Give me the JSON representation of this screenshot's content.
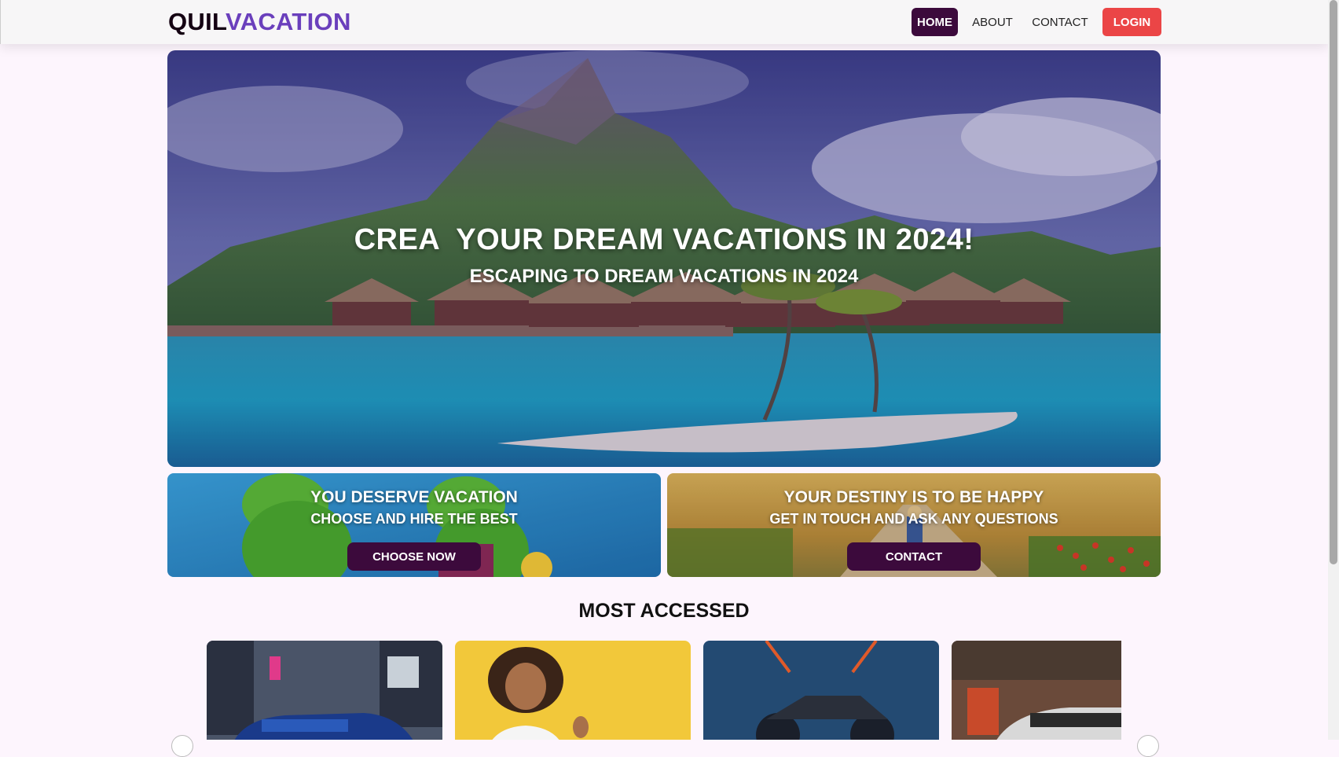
{
  "header": {
    "logo_part1": "QUIL",
    "logo_part2": "VACATION",
    "nav": {
      "home": "HOME",
      "about": "ABOUT",
      "contact": "CONTACT",
      "login": "LOGIN"
    }
  },
  "hero": {
    "title": "CREA  YOUR DREAM VACATIONS IN 2024!",
    "subtitle": "ESCAPING TO DREAM VACATIONS IN 2024"
  },
  "promos": [
    {
      "title": "YOU DESERVE VACATION",
      "subtitle": "CHOOSE AND HIRE THE BEST",
      "button": "CHOOSE NOW"
    },
    {
      "title": "YOUR DESTINY IS TO BE HAPPY",
      "subtitle": "GET IN TOUCH AND ASK ANY QUESTIONS",
      "button": "CONTACT"
    }
  ],
  "most_accessed": {
    "title": "MOST ACCESSED"
  },
  "colors": {
    "brand_dark": "#3c0a3c",
    "brand_purple": "#6a3fbc",
    "login_red": "#eb4546",
    "page_bg": "#fdf5fd"
  }
}
